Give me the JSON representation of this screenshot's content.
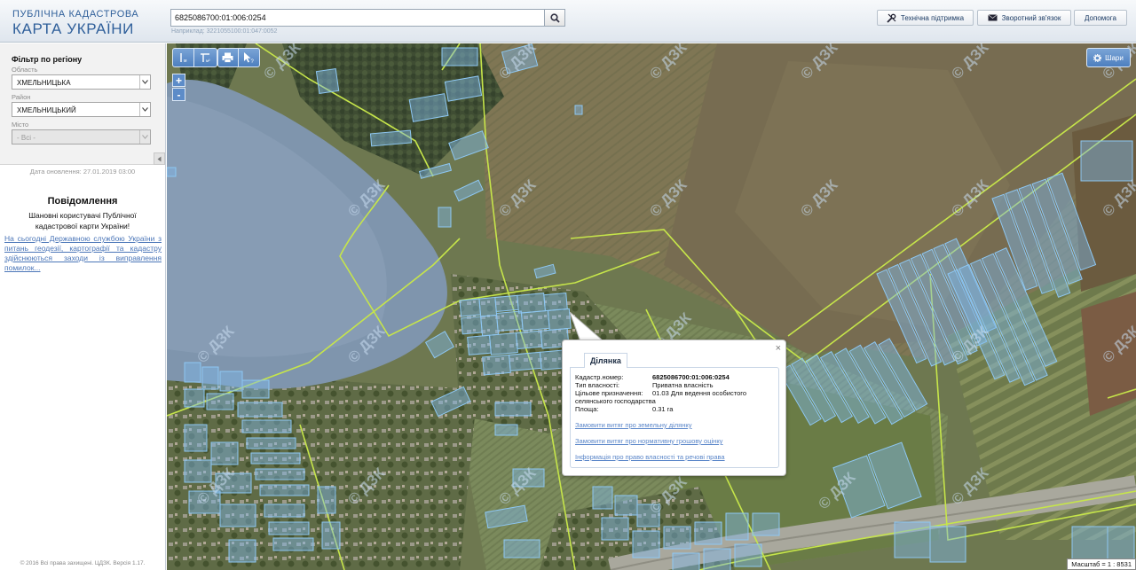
{
  "header": {
    "brand_line1": "ПУБЛІЧНА КАДАСТРОВА",
    "brand_line2": "КАРТА УКРАЇНИ",
    "search_value": "6825086700:01:006:0254",
    "search_hint": "Наприклад: 3221055100:01:047:0052",
    "support_label": "Технічна підтримка",
    "feedback_label": "Зворотний зв'язок",
    "help_label": "Допомога"
  },
  "sidebar": {
    "filter_title": "Фільтр по регіону",
    "region_label": "Область",
    "region_value": "ХМЕЛЬНИЦЬКА",
    "district_label": "Район",
    "district_value": "ХМЕЛЬНИЦЬКИЙ",
    "city_label": "Місто",
    "city_value": "- Всі -",
    "update_date": "Дата оновлення: 27.01.2019 03:00",
    "notice_title": "Повідомлення",
    "notice_text": "Шановні користувачі Публічної кадастрової карти України!",
    "notice_link": "На сьогодні Державною службою України з питань геодезії, картографії та кадастру здійснюються заходи із виправлення помилок...",
    "copyright": "© 2016 Всі права захищені. ЦДЗК. Версія 1.17."
  },
  "map": {
    "layers_label": "Шари",
    "zoom_in": "+",
    "zoom_out": "-",
    "scale": "Масштаб = 1 : 8531",
    "watermark": "© ДЗК"
  },
  "popup": {
    "tab_label": "Ділянка",
    "close": "×",
    "cadastral_label": "Кадастр.номер:",
    "cadastral_value": "6825086700:01:006:0254",
    "ownership_label": "Тип власності:",
    "ownership_value": "Приватна власність",
    "purpose_label": "Цільове призначення:",
    "purpose_value": "01.03 Для ведення особистого",
    "purpose_value2": "селянського господарства",
    "area_label": "Площа:",
    "area_value": "0.31 га",
    "link1": "Замовити витяг про земельну ділянку",
    "link2": "Замовити витяг про нормативну грошову оцінку",
    "link3": "Інформація про право власності та речові права"
  },
  "colors": {
    "parcel": "#7fb8ea",
    "boundary": "#c6e54a",
    "water": "#7b93ab",
    "header_blue": "#2f5f9a"
  }
}
